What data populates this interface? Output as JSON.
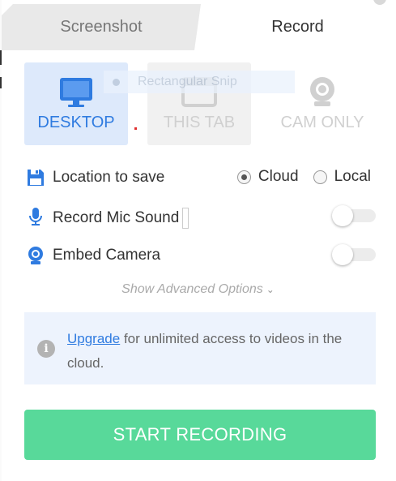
{
  "tabs": [
    {
      "label": "Screenshot",
      "active": false
    },
    {
      "label": "Record",
      "active": true
    }
  ],
  "modes": [
    {
      "label": "DESKTOP",
      "icon": "monitor-icon",
      "selected": true
    },
    {
      "label": "THIS TAB",
      "icon": "browser-tab-icon",
      "selected": false
    },
    {
      "label": "CAM ONLY",
      "icon": "webcam-icon",
      "selected": false
    }
  ],
  "overlay": {
    "snip_label": "Rectangular Snip"
  },
  "settings": {
    "location": {
      "label": "Location to save",
      "icon": "floppy-disk-icon",
      "options": [
        "Cloud",
        "Local"
      ],
      "selected": "Cloud"
    },
    "mic": {
      "label": "Record Mic Sound",
      "icon": "microphone-icon",
      "enabled": false
    },
    "camera": {
      "label": "Embed Camera",
      "icon": "webcam-icon",
      "enabled": false
    }
  },
  "advanced": {
    "label": "Show Advanced Options"
  },
  "info": {
    "link": "Upgrade",
    "text": "for unlimited access to videos in the cloud.",
    "icon": "info-icon"
  },
  "start_button": {
    "label": "START RECORDING"
  },
  "colors": {
    "accent": "#2f7be0",
    "start": "#58d99a",
    "selected_card": "#dde9fb",
    "info_bg": "#edf3fd"
  }
}
